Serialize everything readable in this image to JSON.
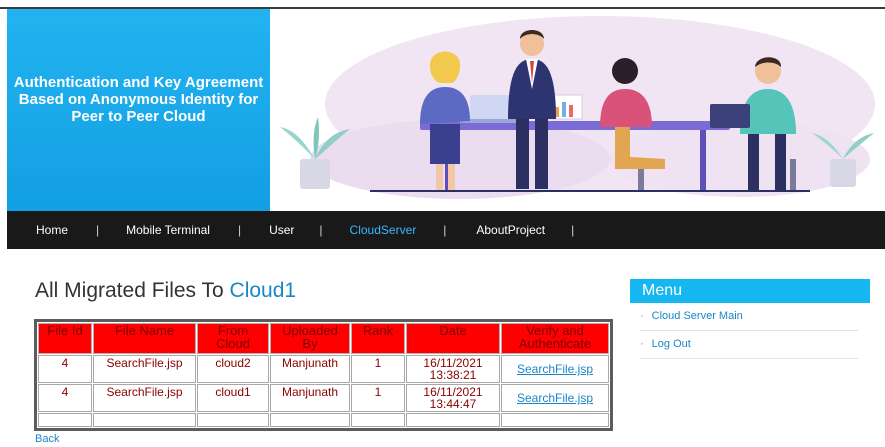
{
  "header": {
    "title": "Authentication and Key Agreement Based on Anonymous Identity for Peer to Peer Cloud"
  },
  "nav": {
    "items": [
      {
        "label": "Home",
        "name": "nav-home"
      },
      {
        "label": "Mobile Terminal",
        "name": "nav-mobile-terminal"
      },
      {
        "label": "User",
        "name": "nav-user"
      },
      {
        "label": "CloudServer",
        "name": "nav-cloudserver",
        "active": true
      },
      {
        "label": "AboutProject",
        "name": "nav-aboutproject"
      }
    ],
    "separator": "|"
  },
  "page": {
    "title_prefix": "All Migrated Files To ",
    "cloud_name": "Cloud1"
  },
  "table": {
    "headers": [
      "File Id",
      "File Name",
      "From Cloud",
      "Uploaded By",
      "Rank",
      "Date",
      "Verify and Authenticate"
    ],
    "rows": [
      {
        "file_id": "4",
        "file_name": "SearchFile.jsp",
        "from_cloud": "cloud2",
        "uploaded_by": "Manjunath",
        "rank": "1",
        "date": "16/11/2021 13:38:21",
        "link": "SearchFile.jsp"
      },
      {
        "file_id": "4",
        "file_name": "SearchFile.jsp",
        "from_cloud": "cloud1",
        "uploaded_by": "Manjunath",
        "rank": "1",
        "date": "16/11/2021 13:44:47",
        "link": "SearchFile.jsp"
      }
    ]
  },
  "back": {
    "label": "Back"
  },
  "menu": {
    "title": "Menu",
    "items": [
      "Cloud Server Main",
      "Log Out"
    ],
    "bullet": "·"
  },
  "colors": {
    "header_panel": "#1aa9ec",
    "navbar": "#191919",
    "nav_active": "#3ab8ff",
    "table_header": "#ff0000",
    "table_text": "#8b0000",
    "link": "#1a86c8",
    "menu_header": "#14b7ef"
  }
}
